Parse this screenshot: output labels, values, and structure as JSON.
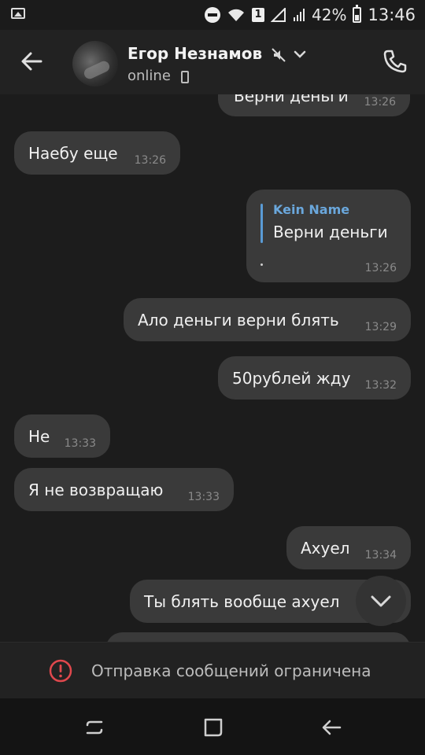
{
  "status_bar": {
    "battery": "42%",
    "time": "13:46",
    "sim": "1"
  },
  "header": {
    "name": "Егор Незнамов",
    "status": "online"
  },
  "messages": [
    {
      "side": "out",
      "text": "Верни деньги",
      "time": "13:26",
      "partial": true
    },
    {
      "side": "in",
      "text": "Наебу еще",
      "time": "13:26"
    },
    {
      "side": "out",
      "quote_author": "Kein Name",
      "quote_text": "Верни деньги",
      "text": ".",
      "time": "13:26"
    },
    {
      "side": "out",
      "text": "Ало деньги верни блять",
      "time": "13:29"
    },
    {
      "side": "out",
      "text": "50рублей жду",
      "time": "13:32"
    },
    {
      "side": "in",
      "text": "Не",
      "time": "13:33"
    },
    {
      "side": "in",
      "text": "Я не возвращаю",
      "time": "13:33"
    },
    {
      "side": "out",
      "text": "Ахуел",
      "time": "13:34"
    },
    {
      "side": "out",
      "text": "Ты блять вообще ахуел",
      "time": ""
    }
  ],
  "restricted_notice": "Отправка сообщений ограничена",
  "colors": {
    "bubble": "#3a3a3a",
    "background": "#1c1c1c",
    "quote_accent": "#5a9bd5"
  }
}
